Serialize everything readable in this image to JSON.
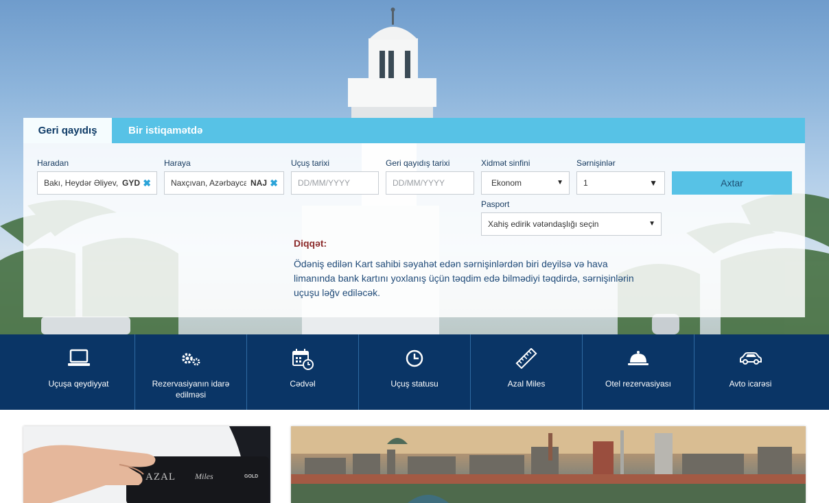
{
  "tabs": {
    "round_trip": "Geri qayıdış",
    "one_way": "Bir istiqamətdə"
  },
  "form": {
    "from": {
      "label": "Haradan",
      "value": "Bakı, Heydər Əliyev, A",
      "code": "GYD"
    },
    "to": {
      "label": "Haraya",
      "value": "Naxçıvan, Azərbaycan",
      "code": "NAJ"
    },
    "depart": {
      "label": "Uçuş tarixi",
      "placeholder": "DD/MM/YYYY"
    },
    "return": {
      "label": "Geri qayıdış tarixi",
      "placeholder": "DD/MM/YYYY"
    },
    "service_class": {
      "label": "Xidmət sinfini",
      "value": "Ekonom"
    },
    "passengers": {
      "label": "Sərnişinlər",
      "value": "1"
    },
    "search_button": "Axtar",
    "passport": {
      "label": "Pasport",
      "value": "Xahiş edirik vətəndaşlığı seçin"
    }
  },
  "warning": {
    "title": "Diqqət:",
    "text": "Ödəniş edilən Kart sahibi səyahət edən sərnişinlərdən biri deyilsə və hava limanında bank kartını yoxlanış üçün təqdim edə bilmədiyi təqdirdə, sərnişinlərin uçuşu ləğv ediləcək."
  },
  "services": [
    {
      "label": "Uçuşa qeydiyyat",
      "icon": "laptop-icon"
    },
    {
      "label": "Rezervasiyanın idarə edilməsi",
      "icon": "gears-icon"
    },
    {
      "label": "Cədvəl",
      "icon": "calendar-clock-icon"
    },
    {
      "label": "Uçuş statusu",
      "icon": "clock-icon"
    },
    {
      "label": "Azal Miles",
      "icon": "ruler-icon"
    },
    {
      "label": "Otel rezervasiyası",
      "icon": "hotel-bell-icon"
    },
    {
      "label": "Avto icarəsi",
      "icon": "car-icon"
    }
  ],
  "promo": {
    "card_brand": "AZAL",
    "card_brand_script": "Miles",
    "card_tier": "GOLD"
  },
  "colors": {
    "accent": "#57c2e6",
    "navy": "#0a3566",
    "warning": "#8b2a2a"
  }
}
